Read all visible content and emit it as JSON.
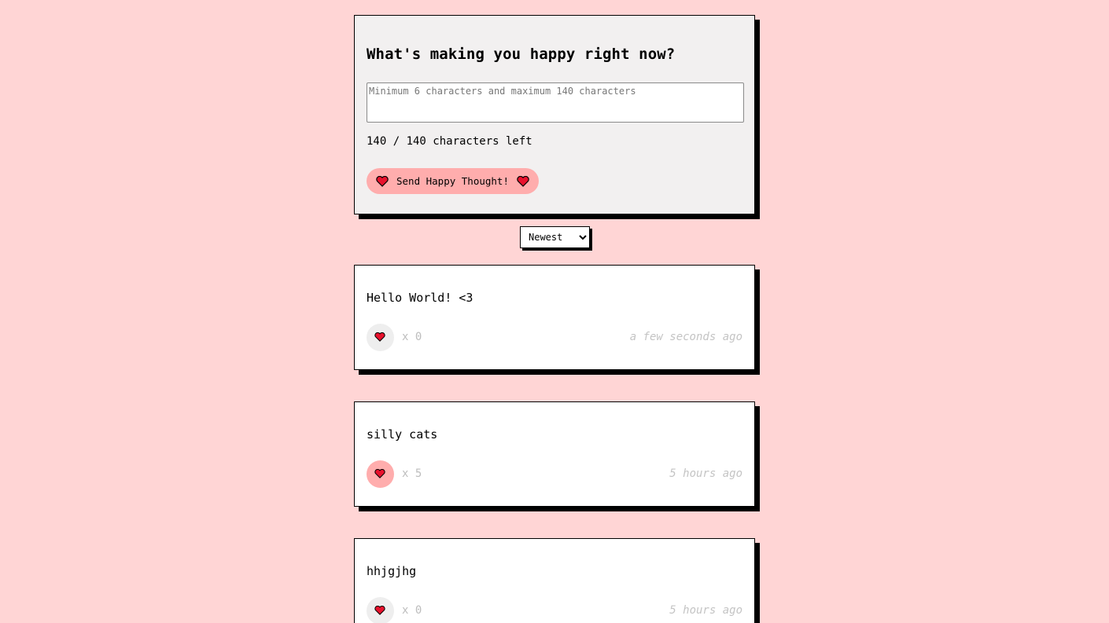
{
  "form": {
    "title": "What's making you happy right now?",
    "input_placeholder": "Minimum 6 characters and maximum 140 characters",
    "input_value": "",
    "counter_text": "140 / 140 characters left",
    "send_label": "Send Happy Thought!"
  },
  "sort": {
    "selected": "Newest",
    "options": [
      "Newest"
    ]
  },
  "thoughts": [
    {
      "message": "Hello World! <3",
      "likes_text": "x 0",
      "time": "a few seconds ago",
      "liked": false
    },
    {
      "message": "silly cats",
      "likes_text": "x 5",
      "time": "5 hours ago",
      "liked": true
    },
    {
      "message": "hhjgjhg",
      "likes_text": "x 0",
      "time": "5 hours ago",
      "liked": false
    }
  ],
  "colors": {
    "background": "#ffd5d5",
    "accent": "#ffadad",
    "heart": "#e8112d"
  }
}
